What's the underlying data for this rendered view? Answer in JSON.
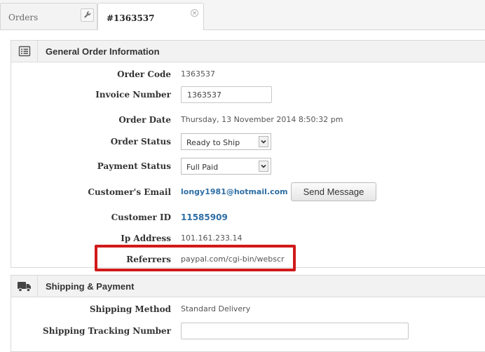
{
  "tabs": [
    {
      "label": "Orders"
    },
    {
      "label": "#1363537"
    }
  ],
  "general": {
    "title": "General Order Information",
    "order_code": {
      "label": "Order Code",
      "value": "1363537"
    },
    "invoice_number": {
      "label": "Invoice Number",
      "value": "1363537"
    },
    "order_date": {
      "label": "Order Date",
      "value": "Thursday, 13 November 2014 8:50:32 pm"
    },
    "order_status": {
      "label": "Order Status",
      "value": "Ready to Ship"
    },
    "payment_status": {
      "label": "Payment Status",
      "value": "Full Paid"
    },
    "customer_email": {
      "label": "Customer's Email",
      "value": "longy1981@hotmail.com",
      "button": "Send Message"
    },
    "customer_id": {
      "label": "Customer ID",
      "value": "11585909"
    },
    "ip_address": {
      "label": "Ip Address",
      "value": "101.161.233.14"
    },
    "referrers": {
      "label": "Referrers",
      "value": "paypal.com/cgi-bin/webscr"
    }
  },
  "shipping": {
    "title": "Shipping & Payment",
    "shipping_method": {
      "label": "Shipping Method",
      "value": "Standard Delivery"
    },
    "tracking_number": {
      "label": "Shipping Tracking Number",
      "value": ""
    }
  },
  "colors": {
    "accent_link": "#2e6da4",
    "highlight": "#d11a1a"
  },
  "icons": [
    "wrench-icon",
    "close-icon",
    "list-icon",
    "truck-icon",
    "chevron-down-icon"
  ]
}
